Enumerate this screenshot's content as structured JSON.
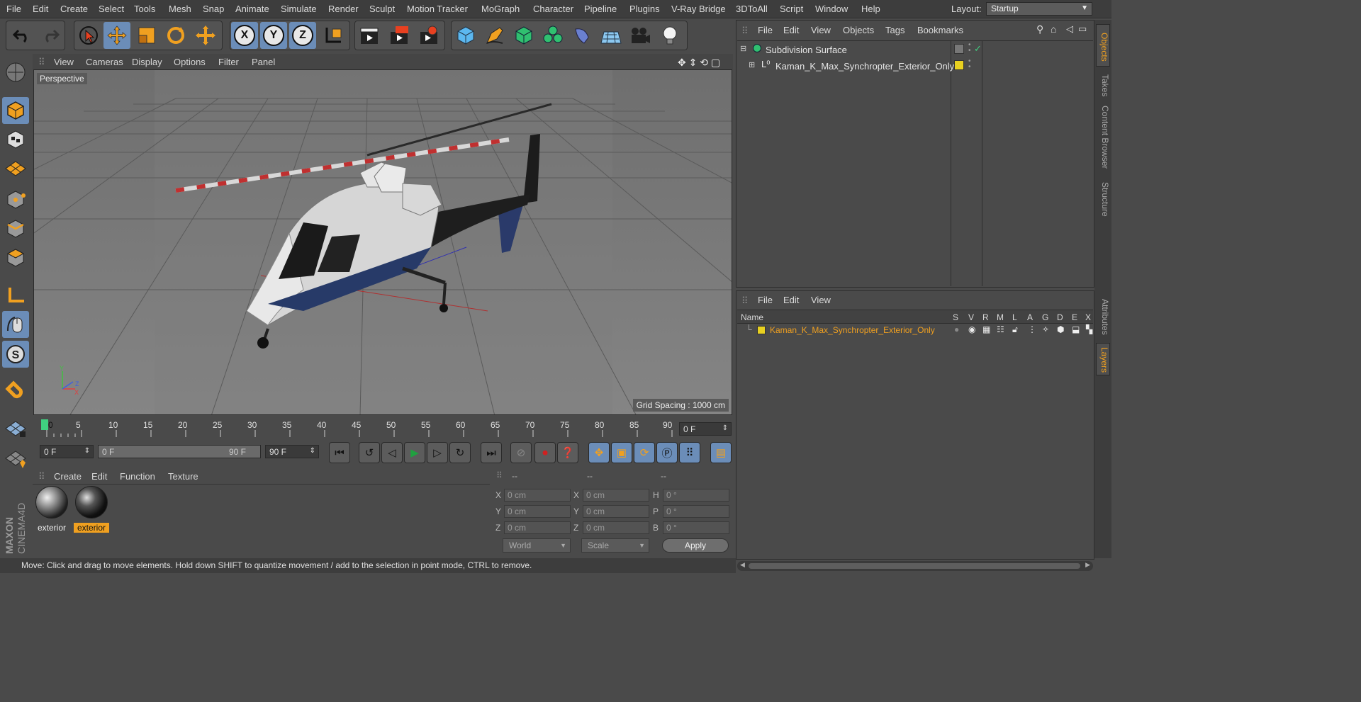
{
  "menubar": {
    "items": [
      "File",
      "Edit",
      "Create",
      "Select",
      "Tools",
      "Mesh",
      "Snap",
      "Animate",
      "Simulate",
      "Render",
      "Sculpt",
      "Motion Tracker",
      "MoGraph",
      "Character",
      "Pipeline",
      "Plugins",
      "V-Ray Bridge",
      "3DToAll",
      "Script",
      "Window",
      "Help"
    ],
    "layout_label": "Layout:",
    "layout_value": "Startup"
  },
  "toolbar": {
    "icons": [
      "undo-icon",
      "redo-icon",
      "live-selection-icon",
      "move-icon",
      "scale-icon",
      "rotate-icon",
      "transform-icon",
      "x-axis-icon",
      "y-axis-icon",
      "z-axis-icon",
      "coordinate-system-icon",
      "render-view-icon",
      "render-picture-viewer-icon",
      "render-settings-icon",
      "cube-icon",
      "pen-icon",
      "subdivision-icon",
      "cloner-icon",
      "deformer-icon",
      "floor-icon",
      "camera-icon",
      "light-icon"
    ],
    "axis_labels": [
      "X",
      "Y",
      "Z"
    ]
  },
  "viewport": {
    "menu": [
      "View",
      "Cameras",
      "Display",
      "Options",
      "Filter",
      "Panel"
    ],
    "label": "Perspective",
    "grid_spacing": "Grid Spacing : 1000 cm"
  },
  "timeline": {
    "ticks": [
      "0",
      "5",
      "10",
      "15",
      "20",
      "25",
      "30",
      "35",
      "40",
      "45",
      "50",
      "55",
      "60",
      "65",
      "70",
      "75",
      "80",
      "85",
      "90"
    ],
    "current_frame": "0 F",
    "start_frame": "0 F",
    "range_start": "0 F",
    "range_end": "90 F",
    "end_frame": "90 F"
  },
  "materials": {
    "menu": [
      "Create",
      "Edit",
      "Function",
      "Texture"
    ],
    "items": [
      "exterior",
      "exterior"
    ]
  },
  "coordinates": {
    "headers": [
      "--",
      "--",
      "--"
    ],
    "pos_labels": [
      "X",
      "Y",
      "Z"
    ],
    "size_labels": [
      "X",
      "Y",
      "Z"
    ],
    "rot_labels": [
      "H",
      "P",
      "B"
    ],
    "pos_values": [
      "0 cm",
      "0 cm",
      "0 cm"
    ],
    "size_values": [
      "0 cm",
      "0 cm",
      "0 cm"
    ],
    "rot_values": [
      "0 °",
      "0 °",
      "0 °"
    ],
    "world_label": "World",
    "scale_label": "Scale",
    "apply_label": "Apply"
  },
  "status": "Move: Click and drag to move elements. Hold down SHIFT to quantize movement / add to the selection in point mode, CTRL to remove.",
  "objects": {
    "menu": [
      "File",
      "Edit",
      "View",
      "Objects",
      "Tags",
      "Bookmarks"
    ],
    "rows": [
      "Subdivision Surface",
      "Kaman_K_Max_Synchropter_Exterior_Only"
    ]
  },
  "layers": {
    "menu": [
      "File",
      "Edit",
      "View"
    ],
    "name_header": "Name",
    "flag_headers": [
      "S",
      "V",
      "R",
      "M",
      "L",
      "A",
      "G",
      "D",
      "E",
      "X"
    ],
    "rows": [
      "Kaman_K_Max_Synchropter_Exterior_Only"
    ]
  },
  "side_tabs": [
    "Objects",
    "Takes",
    "Content Browser",
    "Structure",
    "Attributes",
    "Layers"
  ],
  "brand": "MAXON CINEMA 4D",
  "colors": {
    "accent": "#f0a020",
    "selected_tool": "#6b8db8",
    "layer_color": "#e8d020"
  }
}
